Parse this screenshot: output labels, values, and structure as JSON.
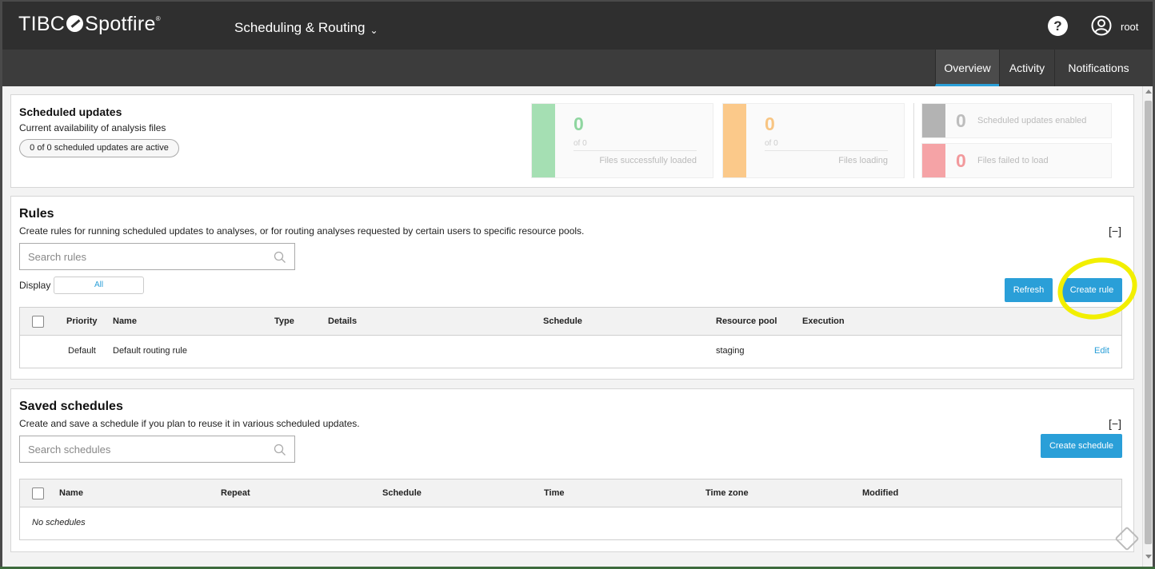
{
  "header": {
    "brand_left": "TIBC",
    "brand_right": "Spotfire",
    "brand_mark": "®",
    "app_title": "Scheduling & Routing",
    "app_title_chevron": "⌄",
    "help_label": "?",
    "user_name": "root"
  },
  "tabs": [
    {
      "label": "Overview",
      "active": true
    },
    {
      "label": "Activity",
      "active": false
    },
    {
      "label": "Notifications",
      "active": false
    }
  ],
  "scheduled_updates": {
    "title": "Scheduled updates",
    "subtitle": "Current availability of analysis files",
    "active_pill": "0 of 0 scheduled updates are active",
    "cards": [
      {
        "value": "0",
        "of_text": "of 0",
        "label": "Files successfully loaded",
        "color": "#a5dfb3",
        "num_color": "#8fd6a0"
      },
      {
        "value": "0",
        "of_text": "of 0",
        "label": "Files loading",
        "color": "#fbc98a",
        "num_color": "#f8c583"
      }
    ],
    "small_cards": [
      {
        "value": "0",
        "label": "Scheduled updates enabled",
        "color": "#b3b3b3",
        "num_color": "#bdbdbd"
      },
      {
        "value": "0",
        "label": "Files failed to load",
        "color": "#f5a3a6",
        "num_color": "#f2999c"
      }
    ]
  },
  "rules": {
    "title": "Rules",
    "description": "Create rules for running scheduled updates to analyses, or for routing analyses requested by certain users to specific resource pools.",
    "collapse": "[−]",
    "search_placeholder": "Search rules",
    "display_label": "Display",
    "display_value": "All",
    "refresh_label": "Refresh",
    "create_label": "Create rule",
    "columns": [
      "Priority",
      "Name",
      "Type",
      "Details",
      "Schedule",
      "Resource pool",
      "Execution"
    ],
    "rows": [
      {
        "priority": "Default",
        "name": "Default routing rule",
        "type": "",
        "details": "",
        "schedule": "",
        "resource_pool": "staging",
        "execution": "",
        "action": "Edit"
      }
    ]
  },
  "saved_schedules": {
    "title": "Saved schedules",
    "description": "Create and save a schedule if you plan to reuse it in various scheduled updates.",
    "collapse": "[−]",
    "search_placeholder": "Search schedules",
    "create_label": "Create schedule",
    "columns": [
      "Name",
      "Repeat",
      "Schedule",
      "Time",
      "Time zone",
      "Modified"
    ],
    "empty_text": "No schedules"
  },
  "colors": {
    "accent": "#2a9fd8",
    "topbar": "#2f2f2f",
    "highlight": "#f2ef00"
  }
}
